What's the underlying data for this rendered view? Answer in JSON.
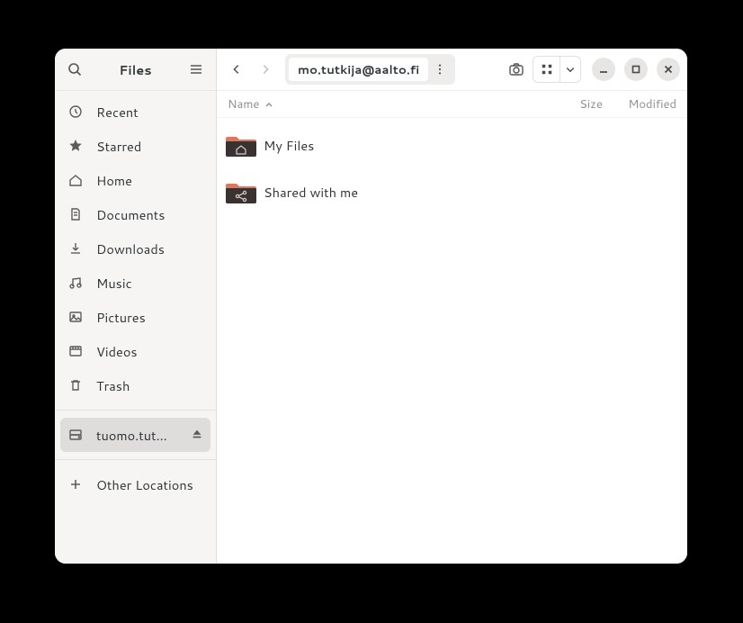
{
  "header": {
    "app_title": "Files",
    "path_segment": "mo.tutkija@aalto.fi"
  },
  "columns": {
    "name": "Name",
    "size": "Size",
    "modified": "Modified"
  },
  "sidebar": {
    "items": [
      {
        "label": "Recent"
      },
      {
        "label": "Starred"
      },
      {
        "label": "Home"
      },
      {
        "label": "Documents"
      },
      {
        "label": "Downloads"
      },
      {
        "label": "Music"
      },
      {
        "label": "Pictures"
      },
      {
        "label": "Videos"
      },
      {
        "label": "Trash"
      }
    ],
    "mounts": [
      {
        "label": "tuomo.tut…"
      }
    ],
    "other": "Other Locations"
  },
  "files": [
    {
      "name": "My Files"
    },
    {
      "name": "Shared with me"
    }
  ]
}
